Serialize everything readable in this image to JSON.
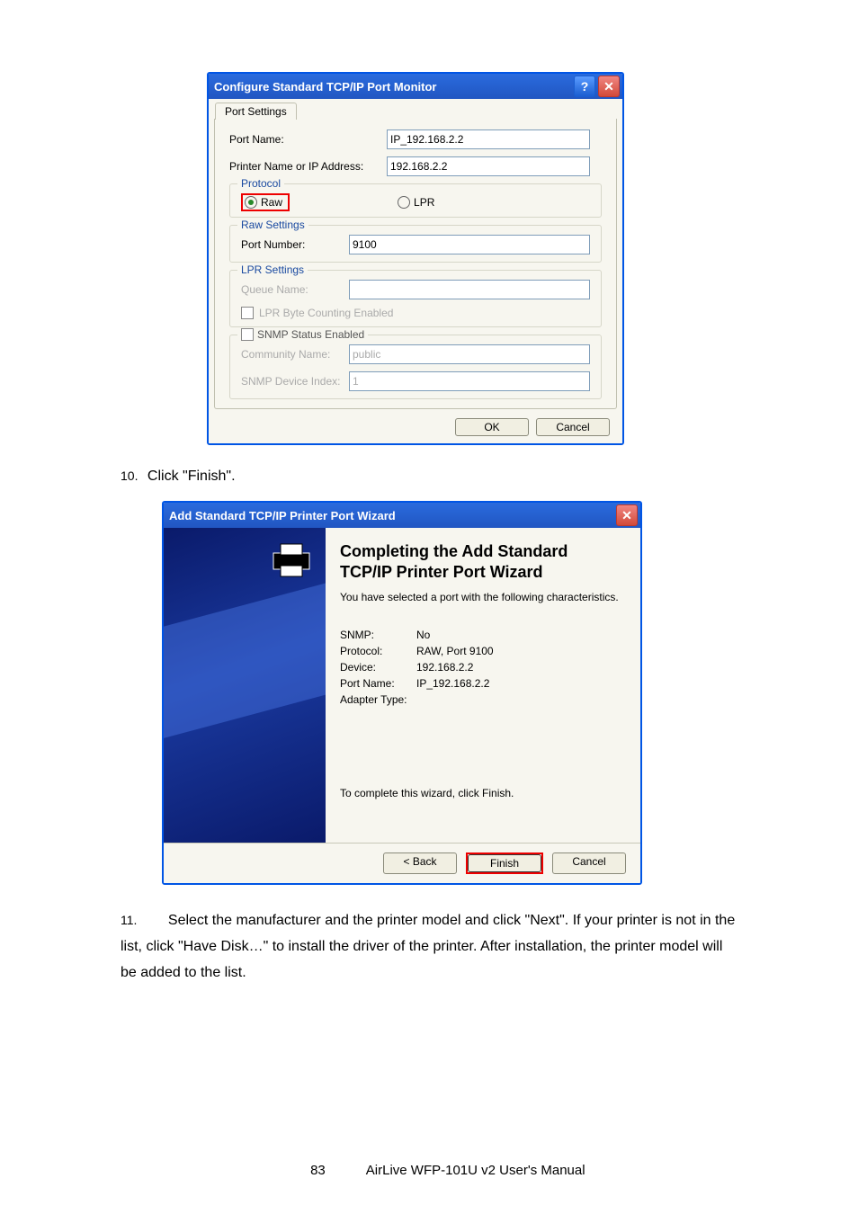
{
  "dialog1": {
    "title": "Configure Standard TCP/IP Port Monitor",
    "tab": "Port Settings",
    "portNameLabel": "Port Name:",
    "portNameValue": "IP_192.168.2.2",
    "printerAddrLabel": "Printer Name or IP Address:",
    "printerAddrValue": "192.168.2.2",
    "protocolLegend": "Protocol",
    "rawLabel": "Raw",
    "lprLabel": "LPR",
    "rawSettingsLegend": "Raw Settings",
    "portNumberLabel": "Port Number:",
    "portNumberValue": "9100",
    "lprSettingsLegend": "LPR Settings",
    "queueNameLabel": "Queue Name:",
    "queueNameValue": "",
    "lprByteLabel": "LPR Byte Counting Enabled",
    "snmpLegend": "SNMP Status Enabled",
    "communityLabel": "Community Name:",
    "communityValue": "public",
    "snmpIndexLabel": "SNMP Device Index:",
    "snmpIndexValue": "1",
    "okLabel": "OK",
    "cancelLabel": "Cancel"
  },
  "step10": {
    "num": "10.",
    "text": "Click \"Finish\"."
  },
  "dialog2": {
    "title": "Add Standard TCP/IP Printer Port Wizard",
    "heading1": "Completing the Add Standard",
    "heading2": "TCP/IP Printer Port Wizard",
    "subtext": "You have selected a port with the following characteristics.",
    "rows": [
      {
        "k": "SNMP:",
        "v": "No"
      },
      {
        "k": "Protocol:",
        "v": "RAW, Port 9100"
      },
      {
        "k": "Device:",
        "v": "192.168.2.2"
      },
      {
        "k": "Port Name:",
        "v": "IP_192.168.2.2"
      },
      {
        "k": "Adapter Type:",
        "v": ""
      }
    ],
    "completeText": "To complete this wizard, click Finish.",
    "backLabel": "< Back",
    "finishLabel": "Finish",
    "cancelLabel": "Cancel"
  },
  "step11": {
    "num": "11.",
    "text": "Select the manufacturer and the printer model and click \"Next\". If your printer is not in the list, click \"Have Disk…\" to install the driver of the printer. After installation, the printer model will be added to the list."
  },
  "footer": {
    "pageNum": "83",
    "manual": "AirLive WFP-101U v2 User's Manual"
  }
}
